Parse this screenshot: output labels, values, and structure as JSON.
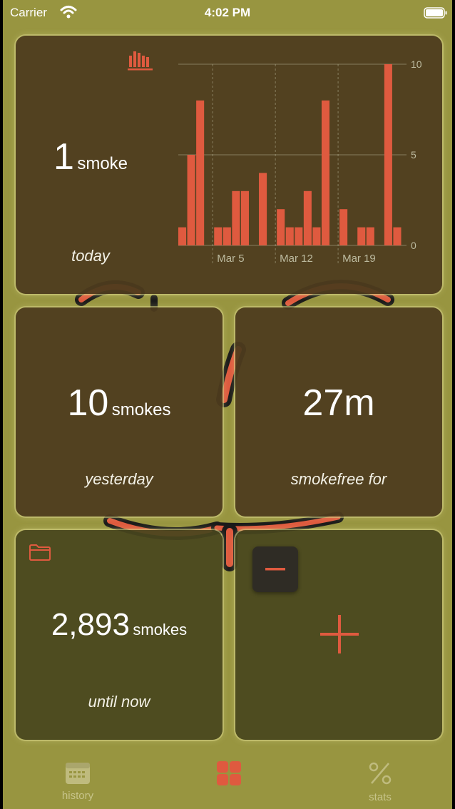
{
  "status_bar": {
    "carrier": "Carrier",
    "time": "4:02 PM"
  },
  "colors": {
    "background": "#989540",
    "card": "#48461e",
    "accent": "#df5a3f",
    "text": "#ffffff"
  },
  "today": {
    "value": "1",
    "unit": "smoke",
    "caption": "today",
    "icon": "bar-chart-icon"
  },
  "yesterday": {
    "value": "10",
    "unit": "smokes",
    "caption": "yesterday"
  },
  "smokefree": {
    "value": "27m",
    "caption": "smokefree for"
  },
  "total": {
    "value": "2,893",
    "unit": "smokes",
    "caption": "until now",
    "icon": "folder-icon"
  },
  "actions": {
    "add_icon": "plus-icon",
    "remove_icon": "minus-icon"
  },
  "tabs": [
    {
      "label": "history",
      "icon": "calendar-icon"
    },
    {
      "label": "",
      "icon": "grid-icon"
    },
    {
      "label": "stats",
      "icon": "percent-icon"
    }
  ],
  "chart_data": {
    "type": "bar",
    "x_tick_labels": [
      "Mar 5",
      "Mar 12",
      "Mar 19"
    ],
    "y_ticks": [
      0,
      5,
      10
    ],
    "ylim": [
      0,
      10
    ],
    "values": [
      1,
      5,
      8,
      0,
      1,
      1,
      3,
      3,
      0,
      4,
      0,
      2,
      1,
      1,
      3,
      1,
      8,
      0,
      2,
      0,
      1,
      1,
      0,
      10,
      1
    ],
    "grid": true
  }
}
